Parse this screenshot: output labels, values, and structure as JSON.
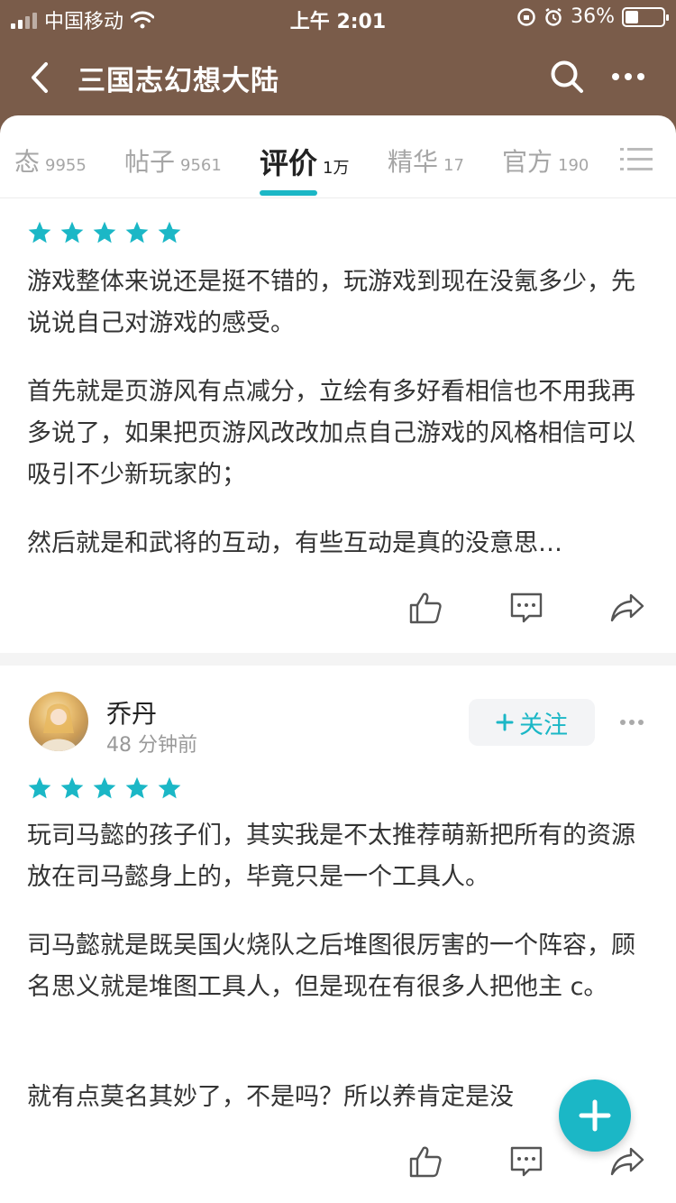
{
  "status_bar": {
    "carrier": "中国移动",
    "time": "上午 2:01",
    "battery": "36%"
  },
  "nav": {
    "title": "三国志幻想大陆",
    "icons": [
      "back-icon",
      "search-icon",
      "more-icon"
    ]
  },
  "tabs": [
    {
      "label": "态",
      "count": "9955"
    },
    {
      "label": "帖子",
      "count": "9561"
    },
    {
      "label": "评价",
      "count": "1万",
      "active": true
    },
    {
      "label": "精华",
      "count": "17"
    },
    {
      "label": "官方",
      "count": "190"
    }
  ],
  "reviews": [
    {
      "stars": 5,
      "paragraphs": [
        "游戏整体来说还是挺不错的，玩游戏到现在没氪多少，先说说自己对游戏的感受。",
        "首先就是页游风有点减分，立绘有多好看相信也不用我再多说了，如果把页游风改改加点自己游戏的风格相信可以吸引不少新玩家的；",
        "然后就是和武将的互动，有些互动是真的没意思…"
      ]
    },
    {
      "user": "乔丹",
      "time": "48 分钟前",
      "follow_label": "关注",
      "stars": 5,
      "paragraphs": [
        "玩司马懿的孩子们，其实我是不太推荐萌新把所有的资源放在司马懿身上的，毕竟只是一个工具人。",
        "司马懿就是既吴国火烧队之后堆图很厉害的一个阵容，顾名思义就是堆图工具人，但是现在有很多人把他主 c。",
        "就有点莫名其妙了，不是吗？所以养肯定是没"
      ]
    }
  ],
  "colors": {
    "header_bg": "#7a5c4a",
    "accent": "#1bb7c6",
    "star": "#1bb7c6"
  }
}
